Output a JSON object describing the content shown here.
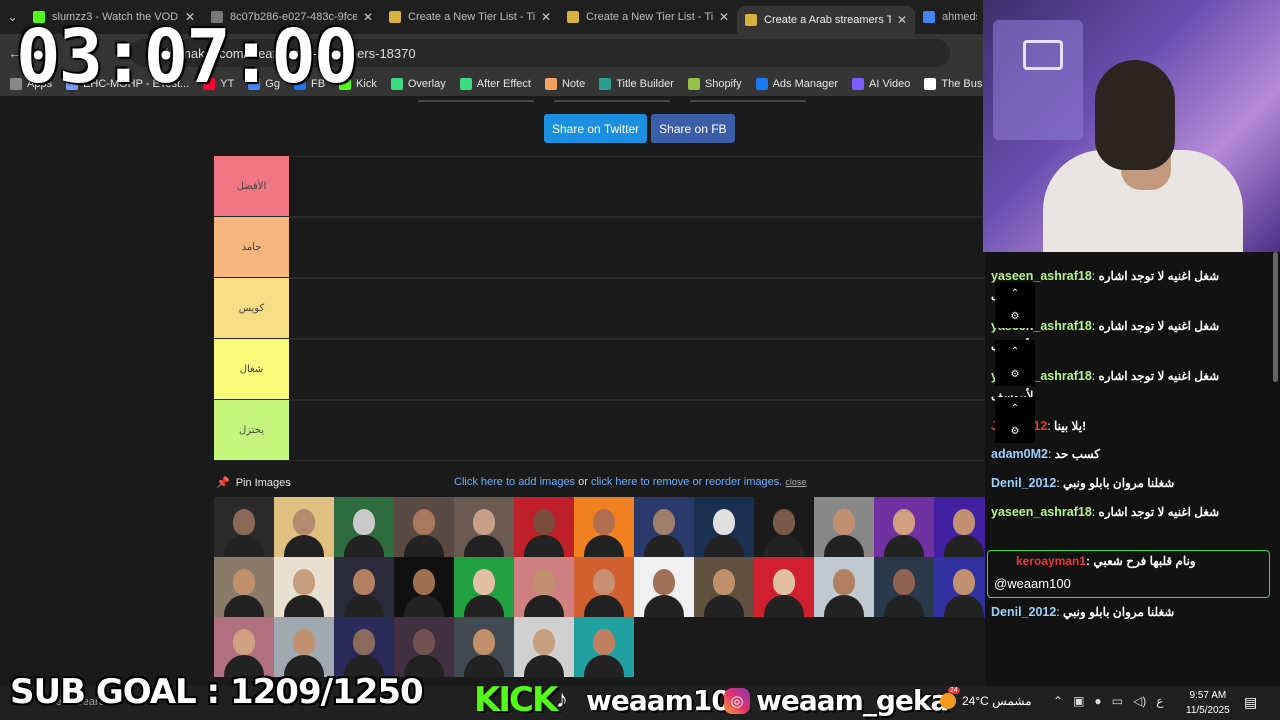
{
  "browser": {
    "tabs": [
      {
        "title": "slumzz3 - Watch the VOD",
        "color": "#53fc18",
        "active": false
      },
      {
        "title": "8c07b286-e027-483c-9fce",
        "color": "#777777",
        "active": false
      },
      {
        "title": "Create a New Tier List - Ti",
        "color": "#d8b13a",
        "active": false
      },
      {
        "title": "Create a New Tier List - Ti",
        "color": "#d8b13a",
        "active": false
      },
      {
        "title": "Create a Arab streamers Ti",
        "color": "#d8b13a",
        "active": true
      },
      {
        "title": "ahmeds",
        "color": "#4285f4",
        "active": false
      }
    ],
    "url": "tiermaker.com/create/arab-streamers-18370",
    "bookmarks": [
      {
        "label": "Apps",
        "icon": "apps-icon",
        "color": "#888888"
      },
      {
        "label": "EHC-MOHP - ETest...",
        "icon": "globe-icon",
        "color": "#7a9cff"
      },
      {
        "label": "YT",
        "icon": "youtube-icon",
        "color": "#ff0033"
      },
      {
        "label": "Gg",
        "icon": "google-icon",
        "color": "#4285f4"
      },
      {
        "label": "FB",
        "icon": "facebook-icon",
        "color": "#1877f2"
      },
      {
        "label": "Kick",
        "icon": "kick-icon",
        "color": "#53fc18"
      },
      {
        "label": "Overlay",
        "icon": "overlay-icon",
        "color": "#3ddc84"
      },
      {
        "label": "After Effect",
        "icon": "fx-icon",
        "color": "#3ddc84"
      },
      {
        "label": "Note",
        "icon": "note-icon",
        "color": "#f4a261"
      },
      {
        "label": "Title Builder",
        "icon": "title-builder-icon",
        "color": "#2a9d8f"
      },
      {
        "label": "Shopify",
        "icon": "shopify-icon",
        "color": "#95bf47"
      },
      {
        "label": "Ads Manager",
        "icon": "meta-icon",
        "color": "#1877f2"
      },
      {
        "label": "AI Video",
        "icon": "ai-icon",
        "color": "#7b5cff"
      },
      {
        "label": "The Busin",
        "icon": "business-icon",
        "color": "#ffffff"
      }
    ]
  },
  "page": {
    "share_twitter": "Share on Twitter",
    "share_fb": "Share on FB",
    "tiers": [
      {
        "label": "الأفضل",
        "color": "#f07681"
      },
      {
        "label": "جامد",
        "color": "#f5b67e"
      },
      {
        "label": "كويس",
        "color": "#f7dd84"
      },
      {
        "label": "شغال",
        "color": "#fafa7b"
      },
      {
        "label": "يختزل",
        "color": "#c6f77d"
      }
    ],
    "pin_label": "Pin Images",
    "add_images": "Click here to add images",
    "or_text": "or",
    "remove_images": "click here to remove or reorder images.",
    "close_text": "close",
    "image_colors": [
      [
        "#2a2a2a",
        "#8a6a56"
      ],
      [
        "#e0c080",
        "#b58a6e"
      ],
      [
        "#2e6b3e",
        "#c9c9c9"
      ],
      [
        "#5a4a44",
        "#a8785e"
      ],
      [
        "#6a5a52",
        "#c8a088"
      ],
      [
        "#c0202a",
        "#7a4a3a"
      ],
      [
        "#f08020",
        "#b07050"
      ],
      [
        "#2a3a6a",
        "#a0806a"
      ],
      [
        "#1a3050",
        "#e0e0e0"
      ],
      [
        "#1a1a1a",
        "#7a5a4a"
      ],
      [
        "#888888",
        "#c09070"
      ],
      [
        "#7030a0",
        "#d0a080"
      ],
      [
        "#4020a0",
        "#c09070"
      ],
      [
        "#8a7a6a",
        "#c0906a"
      ],
      [
        "#e8e0d0",
        "#c8a080"
      ],
      [
        "#2a2a3a",
        "#b08060"
      ],
      [
        "#101010",
        "#a07050"
      ],
      [
        "#20a040",
        "#e0c0a0"
      ],
      [
        "#d08080",
        "#c09070"
      ],
      [
        "#d06030",
        "#c89070"
      ],
      [
        "#f0f0f0",
        "#a07058"
      ],
      [
        "#605040",
        "#c0906a"
      ],
      [
        "#d02030",
        "#e0c0a0"
      ],
      [
        "#c0c8d0",
        "#b08060"
      ],
      [
        "#2a3a4a",
        "#906050"
      ],
      [
        "#3030a0",
        "#c09070"
      ],
      [
        "#b07080",
        "#d0a080"
      ],
      [
        "#a0a8b0",
        "#c09070"
      ],
      [
        "#2a2a5a",
        "#8a6a5a"
      ],
      [
        "#403040",
        "#705050"
      ],
      [
        "#404a50",
        "#c0906a"
      ],
      [
        "#d0d0d0",
        "#c8a080"
      ],
      [
        "#20a0a0",
        "#c08060"
      ]
    ]
  },
  "chat": {
    "messages": [
      {
        "user": "yaseen_ashraf18",
        "color": "#b8f28a",
        "text": "شغل اغنيه لا توجد اشاره",
        "sub": "لأبيوسف"
      },
      {
        "user": "yaseen_ashraf18",
        "color": "#b8f28a",
        "text": "شغل اغنيه لا توجد اشاره",
        "sub": "لأبيوسف"
      },
      {
        "user": "yaseen_ashraf18",
        "color": "#b8f28a",
        "text": "شغل اغنيه لا توجد اشاره",
        "sub": "لأبيوسف"
      },
      {
        "user": "Jana_212",
        "color": "#e03a3a",
        "text": "يلا بينا!",
        "sub": ""
      },
      {
        "user": "adam0M2",
        "color": "#9ad2ff",
        "text": "كسب حد",
        "sub": ""
      },
      {
        "user": "Denil_2012",
        "color": "#9ad2ff",
        "text": "شغلنا مروان بابلو ونبي",
        "sub": ""
      },
      {
        "user": "yaseen_ashraf18",
        "color": "#b8f28a",
        "text": "شغل اغنيه لا توجد اشاره",
        "sub": ""
      },
      {
        "user": "Denil_2012",
        "color": "#9ad2ff",
        "text": "شغلنا مروان بابلو ونبي",
        "sub": ""
      }
    ],
    "highlight": {
      "user": "keroayman1",
      "text": "ونام قلبها فرح شعبي",
      "mention": "@weaam100"
    }
  },
  "overlay": {
    "timer": "03:07:00",
    "sub_goal": "SUB GOAL : 1209/1250",
    "kick": "KICK",
    "handle_kick": "weaam100",
    "handle_insta": "weaam_geka"
  },
  "taskbar": {
    "search": "here to search",
    "weather": "24°C  مشمس",
    "lang": "ع",
    "time": "9:57 AM",
    "date": "11/5/2025"
  }
}
